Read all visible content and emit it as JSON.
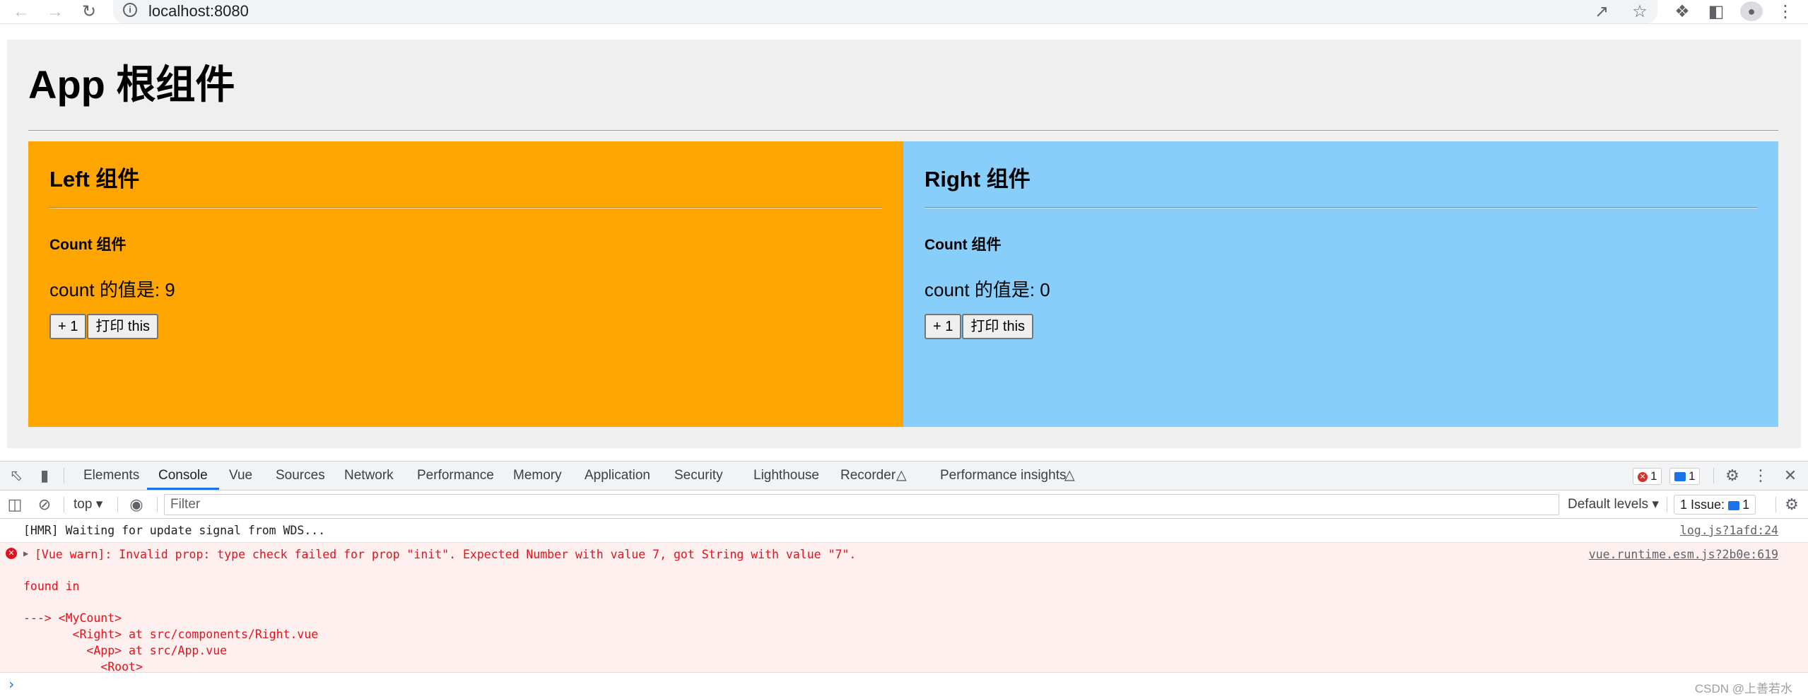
{
  "browser": {
    "url": "localhost:8080",
    "icons": {
      "back": "arrow-left-icon",
      "forward": "arrow-right-icon",
      "reload": "reload-icon",
      "info": "info-icon",
      "share": "share-icon",
      "bookmark": "star-icon",
      "extensions": "puzzle-icon",
      "sidepanel": "side-panel-icon",
      "profile": "profile-icon",
      "menu": "kebab-icon"
    }
  },
  "app": {
    "title": "App 根组件",
    "left": {
      "title": "Left 组件",
      "color": "#ffa500",
      "count_title": "Count 组件",
      "count_text": "count 的值是: 9",
      "increment_label": "+ 1",
      "print_label": "打印 this"
    },
    "right": {
      "title": "Right 组件",
      "color": "#87cefa",
      "count_title": "Count 组件",
      "count_text": "count 的值是: 0",
      "increment_label": "+ 1",
      "print_label": "打印 this"
    }
  },
  "devtools": {
    "tabs": [
      "Elements",
      "Console",
      "Vue",
      "Sources",
      "Network",
      "Performance",
      "Memory",
      "Application",
      "Security",
      "Lighthouse",
      "Recorder",
      "Performance insights"
    ],
    "active_tab": "Console",
    "error_count": "1",
    "message_count": "1",
    "context": "top",
    "filter_placeholder": "Filter",
    "levels": "Default levels",
    "issues_label": "1 Issue:",
    "issues_count": "1",
    "logs": [
      {
        "text": "[HMR] Waiting for update signal from WDS...",
        "source": "log.js?1afd:24"
      }
    ],
    "error": {
      "line1": "[Vue warn]: Invalid prop: type check failed for prop \"init\". Expected Number with value 7, got String with value \"7\".",
      "source": "vue.runtime.esm.js?2b0e:619",
      "line2": "found in",
      "trace": [
        "---> <MyCount>",
        "       <Right> at src/components/Right.vue",
        "         <App> at src/App.vue",
        "           <Root>"
      ]
    },
    "prompt_symbol": "›",
    "watermark": "CSDN @上善若水"
  }
}
